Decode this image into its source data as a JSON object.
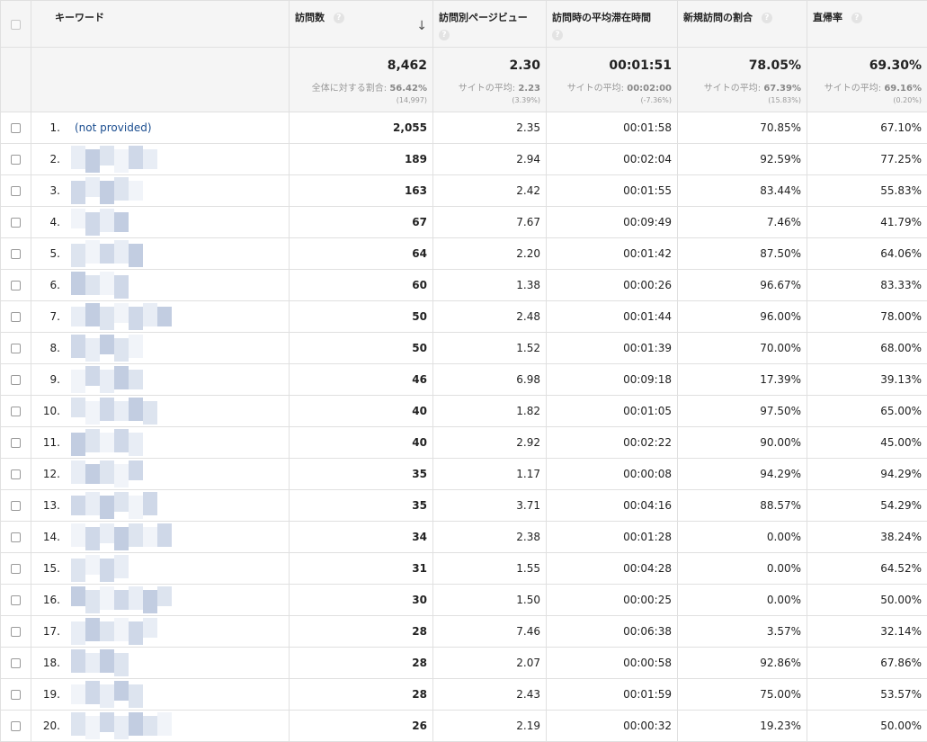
{
  "header": {
    "keyword": "キーワード",
    "visits": "訪問数",
    "pageviews": "訪問別ページビュー",
    "avg_duration": "訪問時の平均滞在時間",
    "new_visits": "新規訪問の割合",
    "bounce": "直帰率",
    "help_glyph": "?",
    "sort_glyph": "↓"
  },
  "totals": {
    "visits": {
      "value": "8,462",
      "label": "全体に対する割合:",
      "label_value": "56.42%",
      "sub": "(14,997)"
    },
    "pageviews": {
      "value": "2.30",
      "label": "サイトの平均:",
      "label_value": "2.23",
      "sub": "(3.39%)"
    },
    "avg_duration": {
      "value": "00:01:51",
      "label": "サイトの平均:",
      "label_value": "00:02:00",
      "sub": "(-7.36%)"
    },
    "new_visits": {
      "value": "78.05%",
      "label": "サイトの平均:",
      "label_value": "67.39%",
      "sub": "(15.83%)"
    },
    "bounce": {
      "value": "69.30%",
      "label": "サイトの平均:",
      "label_value": "69.16%",
      "sub": "(0.20%)"
    }
  },
  "rows": [
    {
      "rank": "1.",
      "keyword": "(not provided)",
      "visits": "2,055",
      "pageviews": "2.35",
      "duration": "00:01:58",
      "new_visits": "70.85%",
      "bounce": "67.10%"
    },
    {
      "rank": "2.",
      "keyword": "",
      "visits": "189",
      "pageviews": "2.94",
      "duration": "00:02:04",
      "new_visits": "92.59%",
      "bounce": "77.25%"
    },
    {
      "rank": "3.",
      "keyword": "",
      "visits": "163",
      "pageviews": "2.42",
      "duration": "00:01:55",
      "new_visits": "83.44%",
      "bounce": "55.83%"
    },
    {
      "rank": "4.",
      "keyword": "",
      "visits": "67",
      "pageviews": "7.67",
      "duration": "00:09:49",
      "new_visits": "7.46%",
      "bounce": "41.79%"
    },
    {
      "rank": "5.",
      "keyword": "",
      "visits": "64",
      "pageviews": "2.20",
      "duration": "00:01:42",
      "new_visits": "87.50%",
      "bounce": "64.06%"
    },
    {
      "rank": "6.",
      "keyword": "",
      "visits": "60",
      "pageviews": "1.38",
      "duration": "00:00:26",
      "new_visits": "96.67%",
      "bounce": "83.33%"
    },
    {
      "rank": "7.",
      "keyword": "",
      "visits": "50",
      "pageviews": "2.48",
      "duration": "00:01:44",
      "new_visits": "96.00%",
      "bounce": "78.00%"
    },
    {
      "rank": "8.",
      "keyword": "",
      "visits": "50",
      "pageviews": "1.52",
      "duration": "00:01:39",
      "new_visits": "70.00%",
      "bounce": "68.00%"
    },
    {
      "rank": "9.",
      "keyword": "",
      "visits": "46",
      "pageviews": "6.98",
      "duration": "00:09:18",
      "new_visits": "17.39%",
      "bounce": "39.13%"
    },
    {
      "rank": "10.",
      "keyword": "",
      "visits": "40",
      "pageviews": "1.82",
      "duration": "00:01:05",
      "new_visits": "97.50%",
      "bounce": "65.00%"
    },
    {
      "rank": "11.",
      "keyword": "",
      "visits": "40",
      "pageviews": "2.92",
      "duration": "00:02:22",
      "new_visits": "90.00%",
      "bounce": "45.00%"
    },
    {
      "rank": "12.",
      "keyword": "",
      "visits": "35",
      "pageviews": "1.17",
      "duration": "00:00:08",
      "new_visits": "94.29%",
      "bounce": "94.29%"
    },
    {
      "rank": "13.",
      "keyword": "",
      "visits": "35",
      "pageviews": "3.71",
      "duration": "00:04:16",
      "new_visits": "88.57%",
      "bounce": "54.29%"
    },
    {
      "rank": "14.",
      "keyword": "",
      "visits": "34",
      "pageviews": "2.38",
      "duration": "00:01:28",
      "new_visits": "0.00%",
      "bounce": "38.24%"
    },
    {
      "rank": "15.",
      "keyword": "",
      "visits": "31",
      "pageviews": "1.55",
      "duration": "00:04:28",
      "new_visits": "0.00%",
      "bounce": "64.52%"
    },
    {
      "rank": "16.",
      "keyword": "",
      "visits": "30",
      "pageviews": "1.50",
      "duration": "00:00:25",
      "new_visits": "0.00%",
      "bounce": "50.00%"
    },
    {
      "rank": "17.",
      "keyword": "",
      "visits": "28",
      "pageviews": "7.46",
      "duration": "00:06:38",
      "new_visits": "3.57%",
      "bounce": "32.14%"
    },
    {
      "rank": "18.",
      "keyword": "",
      "visits": "28",
      "pageviews": "2.07",
      "duration": "00:00:58",
      "new_visits": "92.86%",
      "bounce": "67.86%"
    },
    {
      "rank": "19.",
      "keyword": "",
      "visits": "28",
      "pageviews": "2.43",
      "duration": "00:01:59",
      "new_visits": "75.00%",
      "bounce": "53.57%"
    },
    {
      "rank": "20.",
      "keyword": "",
      "visits": "26",
      "pageviews": "2.19",
      "duration": "00:00:32",
      "new_visits": "19.23%",
      "bounce": "50.00%"
    }
  ],
  "colors": {
    "header_bg": "#f5f5f5",
    "border": "#e0e0e0",
    "link": "#1a4d8f",
    "muted": "#999999",
    "pixelation": [
      "#c2cde1",
      "#cfd8e8",
      "#dde4ef",
      "#e8edf5",
      "#f1f4f9"
    ]
  },
  "icons": {
    "help": "question-circle-icon",
    "sort": "arrow-down-icon",
    "row_select": "checkbox-icon"
  }
}
